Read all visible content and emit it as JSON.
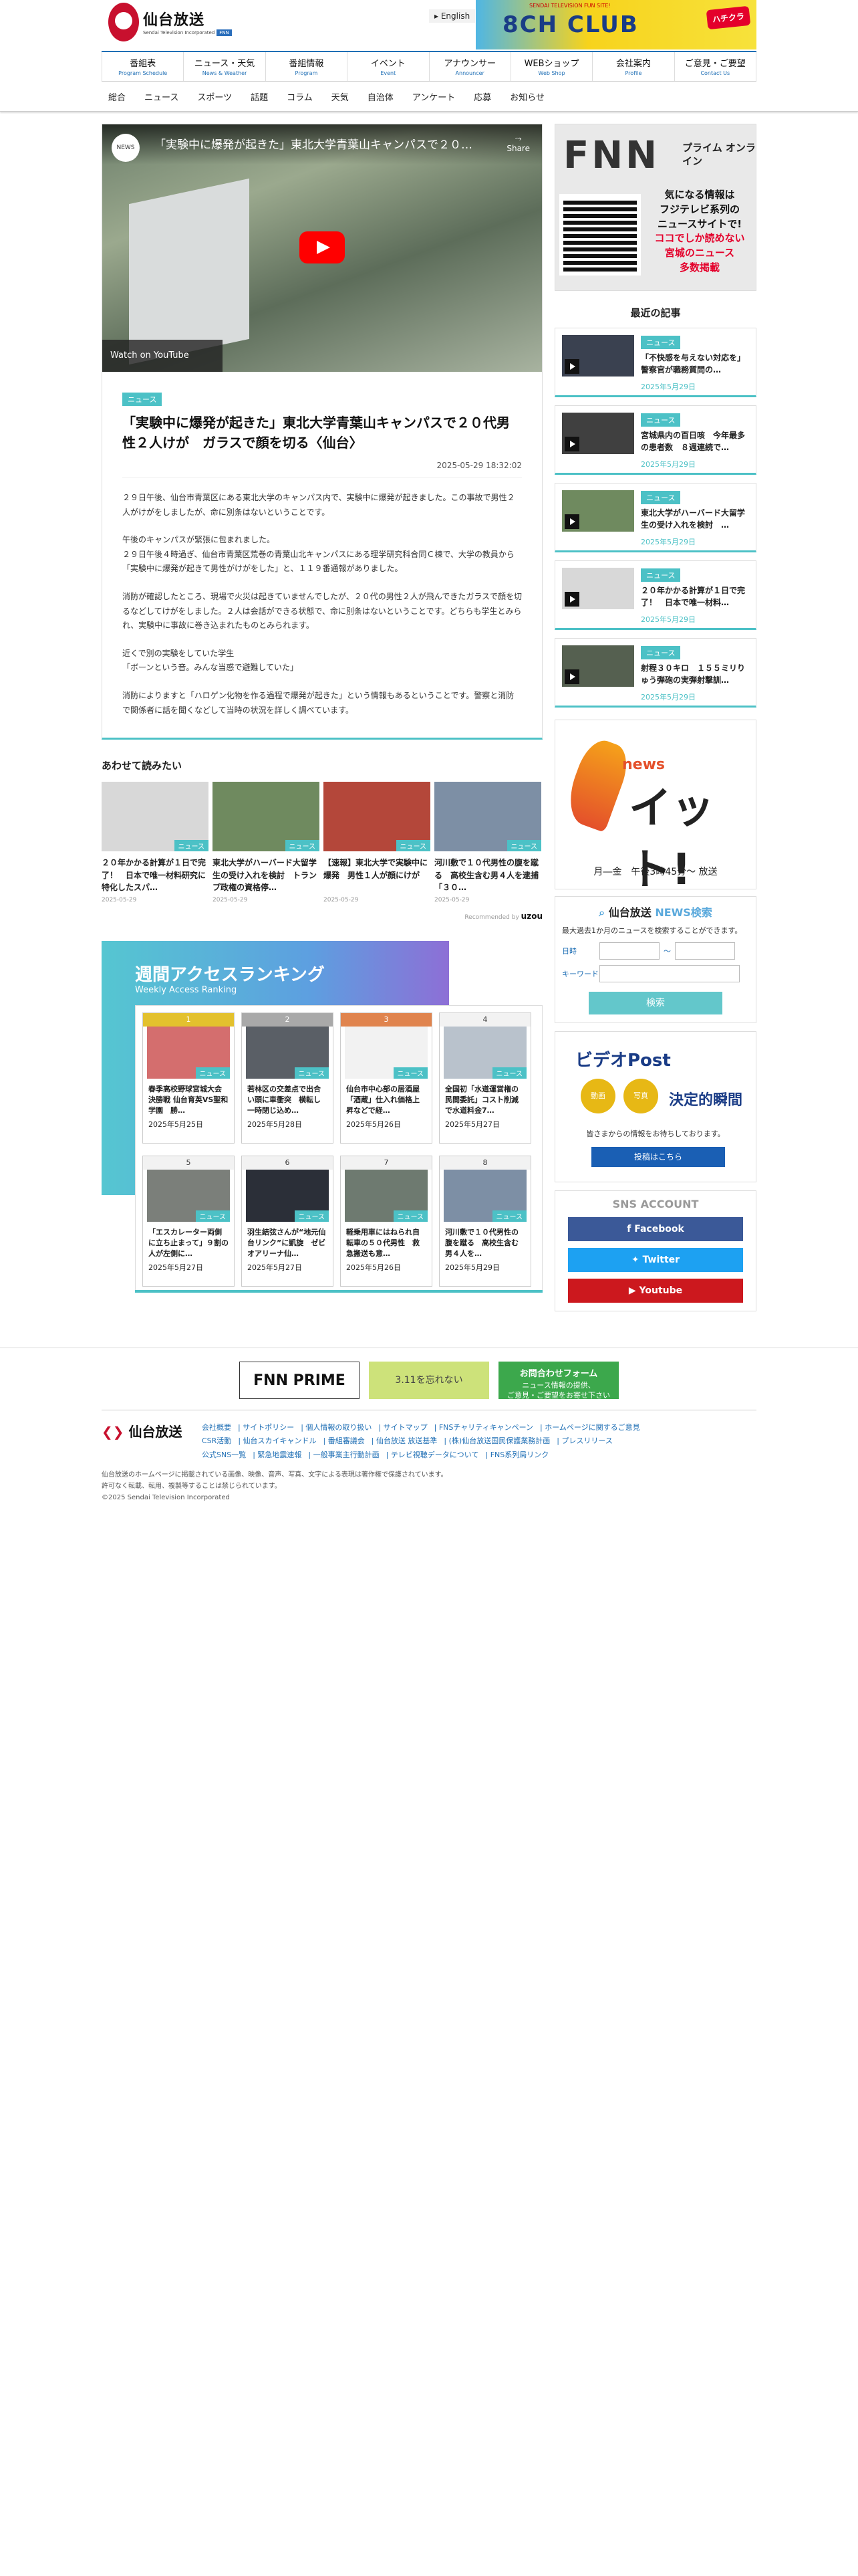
{
  "header": {
    "logo_text": "仙台放送",
    "logo_sub": "Sendai Television Incorporated",
    "logo_badge": "FNN",
    "lang_link": "English",
    "banner": {
      "sub": "SENDAI TELEVISION FUN SITE!",
      "title": "8CH CLUB",
      "badge": "ハチクラ"
    }
  },
  "global_nav": [
    {
      "label": "番組表",
      "sub": "Program Schedule"
    },
    {
      "label": "ニュース・天気",
      "sub": "News & Weather"
    },
    {
      "label": "番組情報",
      "sub": "Program"
    },
    {
      "label": "イベント",
      "sub": "Event"
    },
    {
      "label": "アナウンサー",
      "sub": "Announcer"
    },
    {
      "label": "WEBショップ",
      "sub": "Web Shop"
    },
    {
      "label": "会社案内",
      "sub": "Profile"
    },
    {
      "label": "ご意見・ご要望",
      "sub": "Contact Us"
    }
  ],
  "sub_nav": [
    "総合",
    "ニュース",
    "スポーツ",
    "話題",
    "コラム",
    "天気",
    "自治体",
    "アンケート",
    "応募",
    "お知らせ"
  ],
  "video": {
    "channel": "NEWS",
    "title": "「実験中に爆発が起きた」東北大学青葉山キャンパスで２０…",
    "share": "Share",
    "watch_on": "Watch on  YouTube"
  },
  "article": {
    "tag": "ニュース",
    "title": "「実験中に爆発が起きた」東北大学青葉山キャンパスで２０代男性２人けが　ガラスで顔を切る〈仙台〉",
    "date": "2025-05-29 18:32:02",
    "paragraphs": [
      "２９日午後、仙台市青葉区にある東北大学のキャンパス内で、実験中に爆発が起きました。この事故で男性２人がけがをしましたが、命に別条はないということです。",
      "午後のキャンパスが緊張に包まれました。\n２９日午後４時過ぎ、仙台市青葉区荒巻の青葉山北キャンパスにある理学研究科合同Ｃ棟で、大学の教員から「実験中に爆発が起きて男性がけがをした」と、１１９番通報がありました。",
      "消防が確認したところ、現場で火災は起きていませんでしたが、２０代の男性２人が飛んできたガラスで顔を切るなどしてけがをしました。２人は会話ができる状態で、命に別条はないということです。どちらも学生とみられ、実験中に事故に巻き込まれたものとみられます。",
      "近くで別の実験をしていた学生\n「ボーンという音。みんな当惑で避難していた」",
      "消防によりますと「ハロゲン化物を作る過程で爆発が起きた」という情報もあるということです。警察と消防で関係者に話を聞くなどして当時の状況を詳しく調べています。"
    ]
  },
  "related": {
    "heading": "あわせて読みたい",
    "items": [
      {
        "title": "２０年かかる計算が１日で完了！　日本で唯一材料研究に特化したスパ…",
        "date": "2025-05-29",
        "tag": "ニュース"
      },
      {
        "title": "東北大学がハーバード大留学生の受け入れを検討　トランプ政権の資格停…",
        "date": "2025-05-29",
        "tag": "ニュース"
      },
      {
        "title": "【速報】東北大学で実験中に爆発　男性１人が顔にけが",
        "date": "2025-05-29",
        "tag": "ニュース"
      },
      {
        "title": "河川敷で１０代男性の腹を蹴る　高校生含む男４人を逮捕 「３０…",
        "date": "2025-05-29",
        "tag": "ニュース"
      }
    ],
    "recommended_by": "Recommended by",
    "recommended_brand": "uzou"
  },
  "ranking": {
    "title": "週間アクセスランキング",
    "sub": "Weekly Access Ranking",
    "items": [
      {
        "rank": "1",
        "title": "春季高校野球宮城大会決勝戦 仙台育英VS聖和学園　勝…",
        "date": "2025年5月25日"
      },
      {
        "rank": "2",
        "title": "若林区の交差点で出合い頭に車衝突　横転し一時閉じ込め…",
        "date": "2025年5月28日"
      },
      {
        "rank": "3",
        "title": "仙台市中心部の居酒屋「酒蔵」仕入れ価格上昇などで経…",
        "date": "2025年5月26日"
      },
      {
        "rank": "4",
        "title": "全国初「水道運営権の民間委託」コスト削減で水道料金7…",
        "date": "2025年5月27日"
      },
      {
        "rank": "5",
        "title": "「エスカレーター両側に立ち止まって」９割の人が左側に…",
        "date": "2025年5月27日"
      },
      {
        "rank": "6",
        "title": "羽生結弦さんが“地元仙台リンク”に凱旋　ゼビオアリーナ仙…",
        "date": "2025年5月27日"
      },
      {
        "rank": "7",
        "title": "軽乗用車にはねられ自転車の５０代男性　救急搬送も意…",
        "date": "2025年5月26日"
      },
      {
        "rank": "8",
        "title": "河川敷で１０代男性の腹を蹴る　高校生含む男４人を…",
        "date": "2025年5月29日"
      }
    ],
    "tag": "ニュース"
  },
  "sidebar": {
    "fnn": {
      "logo": "FNN",
      "prime": "プライム オンライン",
      "copy1": "気になる情報は",
      "copy2": "フジテレビ系列の",
      "copy3": "ニュースサイトで!",
      "copy4": "ココでしか読めない",
      "copy5": "宮城のニュース",
      "copy6": "多数掲載"
    },
    "recent_heading": "最近の記事",
    "recent": [
      {
        "tag": "ニュース",
        "title": "「不快感を与えない対応を」警察官が職務質問の…",
        "date": "2025年5月29日"
      },
      {
        "tag": "ニュース",
        "title": "宮城県内の百日咳　今年最多の患者数　８週連続で…",
        "date": "2025年5月29日"
      },
      {
        "tag": "ニュース",
        "title": "東北大学がハーバード大留学生の受け入れを検討　…",
        "date": "2025年5月29日"
      },
      {
        "tag": "ニュース",
        "title": "２０年かかる計算が１日で完了！　日本で唯一材料…",
        "date": "2025年5月29日"
      },
      {
        "tag": "ニュース",
        "title": "射程３０キロ　１５５ミリりゅう弾砲の実弾射撃訓…",
        "date": "2025年5月29日"
      }
    ],
    "it": {
      "news": "news",
      "title": "イット!",
      "time": "月―金　午後3時45分～ 放送"
    },
    "search": {
      "title_brand": "仙台放送",
      "title_news": "NEWS検索",
      "note": "最大過去1か月のニュースを検索することができます。",
      "date_label": "日時",
      "tilde": "～",
      "keyword_label": "キーワード",
      "button": "検索"
    },
    "post": {
      "title": "ビデオPost",
      "icon1": "動画",
      "icon2": "写真",
      "copy": "決定的瞬間",
      "note": "皆さまからの情報をお待ちしております。",
      "button": "投稿はこちら"
    },
    "sns": {
      "heading": "SNS ACCOUNT",
      "facebook": "Facebook",
      "twitter": "Twitter",
      "youtube": "Youtube"
    }
  },
  "footer": {
    "banner1": "FNN PRIME",
    "banner2": "3.11を忘れない",
    "banner3_line1": "お問合わせフォーム",
    "banner3_line2": "ニュース情報の提供、",
    "banner3_line3": "ご意見・ご要望をお寄せ下さい",
    "logo": "仙台放送",
    "links": [
      "会社概要",
      "サイトポリシー",
      "個人情報の取り扱い",
      "サイトマップ",
      "FNSチャリティキャンペーン",
      "ホームページに関するご意見",
      "CSR活動",
      "仙台スカイキャンドル",
      "番組審議会",
      "仙台放送 放送基準",
      "(株)仙台放送国民保護業務計画",
      "プレスリリース",
      "公式SNS一覧",
      "緊急地震速報",
      "一般事業主行動計画",
      "テレビ視聴データについて",
      "FNS系列局リンク"
    ],
    "copy1": "仙台放送のホームページに掲載されている画像、映像、音声、写真、文字による表現は著作権で保護されています。",
    "copy2": "許可なく転載、転用、複製等することは禁じられています。",
    "copy3": "©2025 Sendai Television Incorporated"
  }
}
